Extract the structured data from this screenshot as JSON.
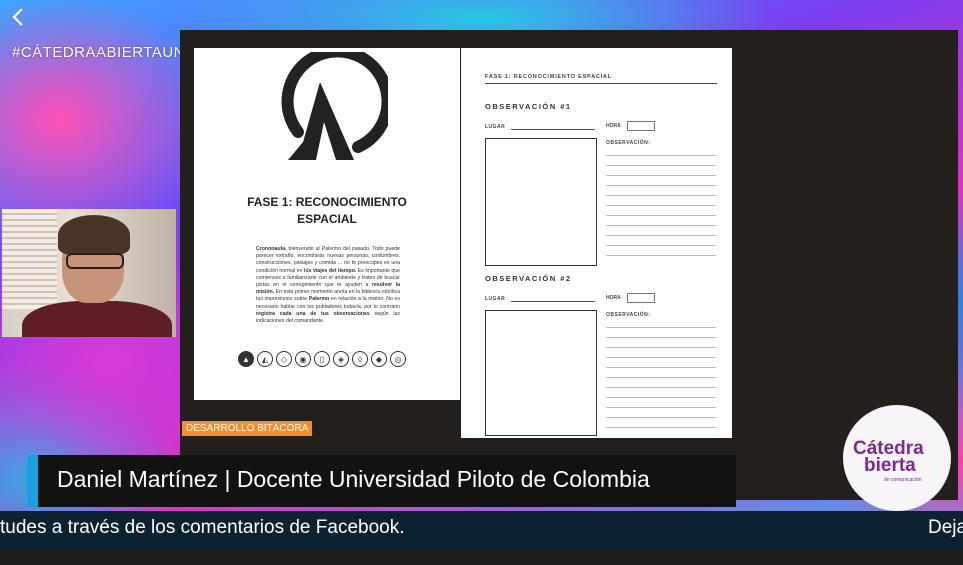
{
  "overlay": {
    "hashtag": "#CÁTEDRAABIERTAUNIMINUTO",
    "section_tag": "DESARROLLO BITÁCORA"
  },
  "document_left": {
    "phase_title_line1": "FASE 1: RECONOCIMIENTO",
    "phase_title_line2": "ESPACIAL",
    "paragraph": [
      {
        "text": "Crononauta",
        "bold": true
      },
      {
        "text": ", bienvenido al Palermo del pasado. Todo puede parecer extraño, encontrarás nuevas personas, costumbres, construcciones, paisajes y comida ... no te preocupes es una condición normal en ",
        "bold": false
      },
      {
        "text": "los viajes del tiempo.",
        "bold": true
      },
      {
        "text": " Es importante que comiences a familiarizarte con el ambiente y trates de buscar pistas en el corregimiento que te ayuden a ",
        "bold": false
      },
      {
        "text": "resolver la misión.",
        "bold": true
      },
      {
        "text": " En este primer momento anota en la ",
        "bold": false
      },
      {
        "text": "bitácora robótica",
        "bold": false
      },
      {
        "text": " tus impresiones sobre ",
        "bold": false
      },
      {
        "text": "Palermo",
        "bold": true
      },
      {
        "text": " en relación a la misión. No es necesario hablar con los pobladores todavía, por lo contrario ",
        "bold": false
      },
      {
        "text": "registra cada una de tus observaciones",
        "bold": true
      },
      {
        "text": " según las indicaciones del comandante.",
        "bold": false
      }
    ],
    "icons": [
      "compass-icon",
      "mountain-icon",
      "diamond-icon",
      "eye-icon",
      "door-icon",
      "gem-icon",
      "shield-icon",
      "rhombus-icon",
      "target-icon"
    ]
  },
  "document_right": {
    "header": "FASE 1: RECONOCIMIENTO ESPACIAL",
    "observations": [
      {
        "title": "OBSERVACIÓN #1",
        "place_label": "LUGAR",
        "time_label": "HORA",
        "obs_label": "OBSERVACIÓN:"
      },
      {
        "title": "OBSERVACIÓN #2",
        "place_label": "LUGAR",
        "time_label": "HORA",
        "obs_label": "OBSERVACIÓN:"
      }
    ]
  },
  "lower_third": {
    "name": "Daniel Martínez | Docente Universidad Piloto de Colombia"
  },
  "ticker": {
    "text_main": "tudes a través de los comentarios de Facebook.",
    "text_next": "Deja"
  },
  "brand": {
    "line1": "Cátedra",
    "line2": "bierta",
    "sub": "de comunicación",
    "color": "#7a2c8e"
  },
  "colors": {
    "accent_blue": "#1a9fe0",
    "section_tag": "#f28e2b"
  }
}
